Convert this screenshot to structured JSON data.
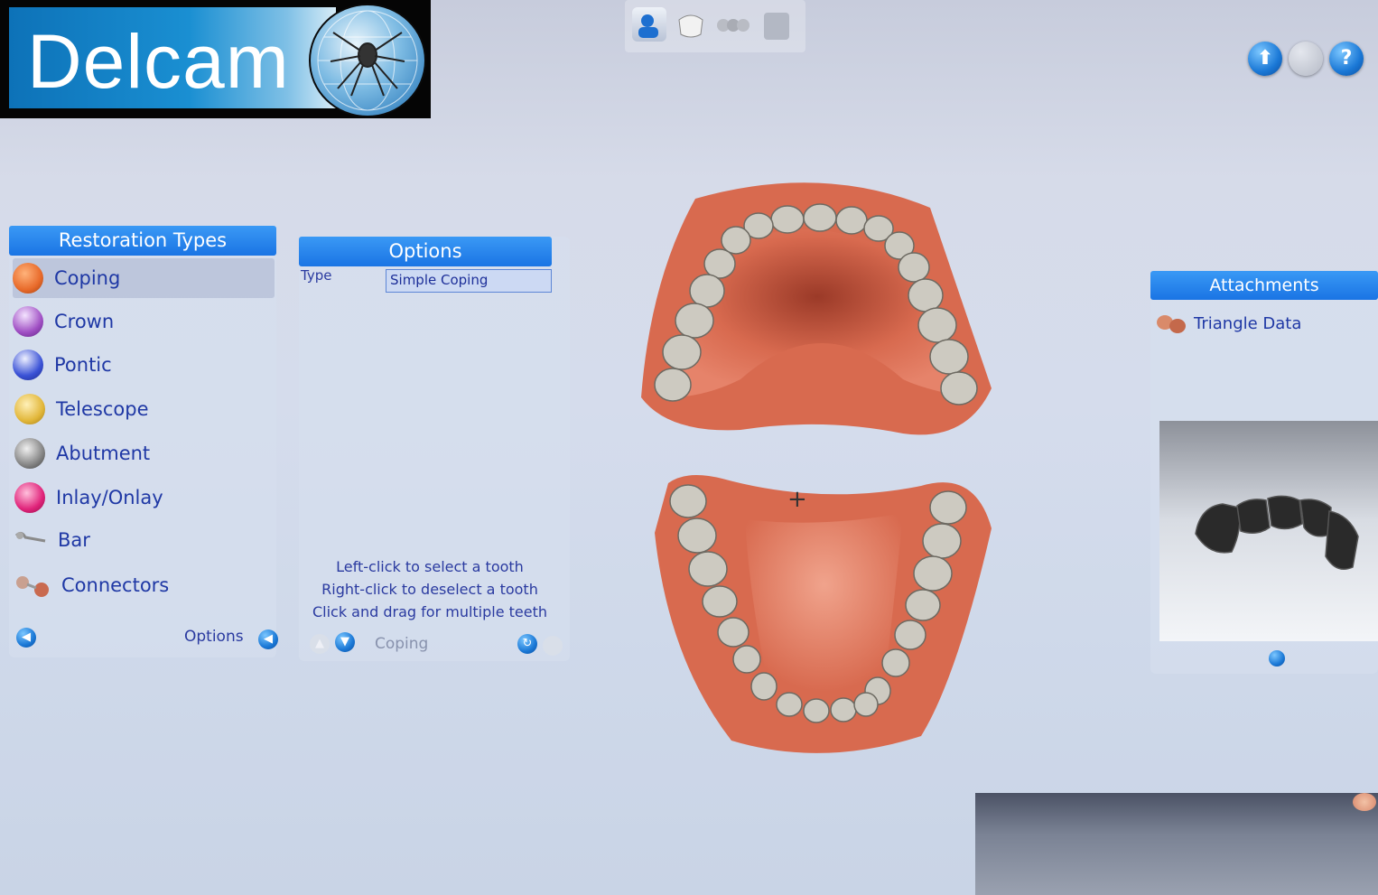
{
  "logo": {
    "text": "Delcam",
    "globe": "spider-globe-logo"
  },
  "toolbar": {
    "icons": [
      "patient-icon",
      "crown-icon",
      "bridge-icon",
      "model-icon"
    ]
  },
  "top_right": {
    "buttons": [
      "upload-icon",
      "disabled-icon",
      "help-icon"
    ],
    "up_glyph": "⬆",
    "help_glyph": "?"
  },
  "restoration_types": {
    "title": "Restoration Types",
    "items": [
      {
        "label": "Coping",
        "color": "#e86a2a"
      },
      {
        "label": "Crown",
        "color": "#a04fc4"
      },
      {
        "label": "Pontic",
        "color": "#3a52d6"
      },
      {
        "label": "Telescope",
        "color": "#e2b73a"
      },
      {
        "label": "Abutment",
        "color": "#8e8e8e"
      },
      {
        "label": "Inlay/Onlay",
        "color": "#e0237a"
      },
      {
        "label": "Bar",
        "color": "#9a9a9a"
      },
      {
        "label": "Connectors",
        "color": "#c96a50"
      }
    ],
    "footer_label": "Options"
  },
  "options": {
    "title": "Options",
    "type_label": "Type",
    "type_value": "Simple Coping",
    "hints": [
      "Left-click to select a tooth",
      "Right-click to deselect a tooth",
      "Click and drag for multiple teeth"
    ],
    "footer_label": "Coping"
  },
  "attachments": {
    "title": "Attachments",
    "item_label": "Triangle Data",
    "item_icon": "triangle-data-icon"
  },
  "colors": {
    "accent": "#1a74e4",
    "text_blue": "#1f38a5",
    "gum": "#d86a4f",
    "teeth": "#cdcac1"
  }
}
